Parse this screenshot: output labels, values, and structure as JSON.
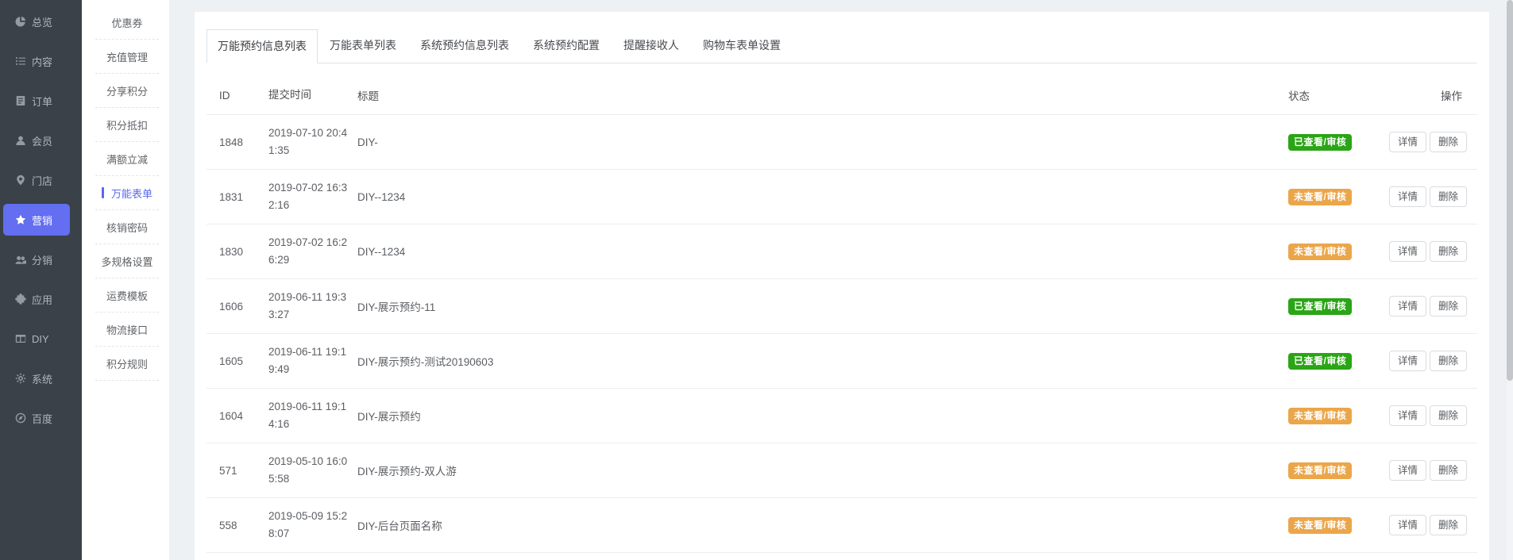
{
  "colors": {
    "accent_purple": "#636ff0",
    "accent_blue": "#5968ef",
    "status_viewed_green": "#2aa515",
    "status_unviewed_orange": "#eba64a",
    "sidebar_dark": "#3a4148"
  },
  "sidebar": {
    "items": [
      {
        "label": "总览",
        "icon": "pie-icon",
        "active": false
      },
      {
        "label": "内容",
        "icon": "list-icon",
        "active": false
      },
      {
        "label": "订单",
        "icon": "document-icon",
        "active": false
      },
      {
        "label": "会员",
        "icon": "user-icon",
        "active": false
      },
      {
        "label": "门店",
        "icon": "location-icon",
        "active": false
      },
      {
        "label": "营销",
        "icon": "star-icon",
        "active": true
      },
      {
        "label": "分销",
        "icon": "users-icon",
        "active": false
      },
      {
        "label": "应用",
        "icon": "puzzle-icon",
        "active": false
      },
      {
        "label": "DIY",
        "icon": "layout-icon",
        "active": false
      },
      {
        "label": "系统",
        "icon": "gear-icon",
        "active": false
      },
      {
        "label": "百度",
        "icon": "compass-icon",
        "active": false
      }
    ]
  },
  "submenu": {
    "items": [
      {
        "label": "优惠券",
        "active": false
      },
      {
        "label": "充值管理",
        "active": false
      },
      {
        "label": "分享积分",
        "active": false
      },
      {
        "label": "积分抵扣",
        "active": false
      },
      {
        "label": "满额立减",
        "active": false
      },
      {
        "label": "万能表单",
        "active": true
      },
      {
        "label": "核销密码",
        "active": false
      },
      {
        "label": "多规格设置",
        "active": false
      },
      {
        "label": "运费模板",
        "active": false
      },
      {
        "label": "物流接口",
        "active": false
      },
      {
        "label": "积分规则",
        "active": false
      }
    ]
  },
  "tabs": [
    {
      "label": "万能预约信息列表",
      "active": true
    },
    {
      "label": "万能表单列表",
      "active": false
    },
    {
      "label": "系统预约信息列表",
      "active": false
    },
    {
      "label": "系统预约配置",
      "active": false
    },
    {
      "label": "提醒接收人",
      "active": false
    },
    {
      "label": "购物车表单设置",
      "active": false
    }
  ],
  "table": {
    "columns": [
      "ID",
      "提交时间",
      "标题",
      "状态",
      "操作"
    ],
    "status_labels": {
      "viewed": "已查看/审核",
      "unviewed": "未查看/审核"
    },
    "actions": [
      "详情",
      "删除"
    ],
    "rows": [
      {
        "id": "1848",
        "time": "2019-07-10 20:41:35",
        "title": "DIY-",
        "status": "viewed"
      },
      {
        "id": "1831",
        "time": "2019-07-02 16:32:16",
        "title": "DIY--1234",
        "status": "unviewed"
      },
      {
        "id": "1830",
        "time": "2019-07-02 16:26:29",
        "title": "DIY--1234",
        "status": "unviewed"
      },
      {
        "id": "1606",
        "time": "2019-06-11 19:33:27",
        "title": "DIY-展示预约-11",
        "status": "viewed"
      },
      {
        "id": "1605",
        "time": "2019-06-11 19:19:49",
        "title": "DIY-展示预约-测试20190603",
        "status": "viewed"
      },
      {
        "id": "1604",
        "time": "2019-06-11 19:14:16",
        "title": "DIY-展示预约",
        "status": "unviewed"
      },
      {
        "id": "571",
        "time": "2019-05-10 16:05:58",
        "title": "DIY-展示预约-双人游",
        "status": "unviewed"
      },
      {
        "id": "558",
        "time": "2019-05-09 15:28:07",
        "title": "DIY-后台页面名称",
        "status": "unviewed"
      }
    ]
  }
}
